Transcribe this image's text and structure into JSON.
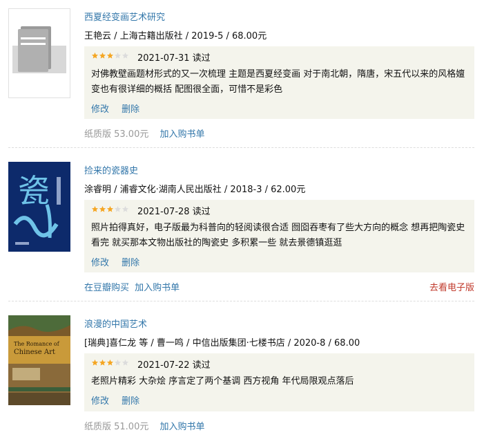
{
  "books": [
    {
      "title": "西夏经变画艺术研究",
      "pub": "王艳云 / 上海古籍出版社 / 2019-5 / 68.00元",
      "rating": 3,
      "date": "2021-07-31 读过",
      "comment": "对佛教壁画题材形式的又一次梳理 主题是西夏经变画 对于南北朝，隋唐，宋五代以来的风格嬗变也有很详细的概括 配图很全面，可惜不是彩色",
      "edit_label": "修改",
      "delete_label": "删除",
      "price_label": "纸质版 53.00元",
      "cart_label": "加入购书单",
      "cover_icon": "book-placeholder-icon"
    },
    {
      "title": "捡来的瓷器史",
      "pub": "涂睿明 / 浦睿文化·湖南人民出版社 / 2018-3 / 62.00元",
      "rating": 3,
      "date": "2021-07-28 读过",
      "comment": "照片拍得真好，电子版最为科普向的轻阅读很合适 囫囵吞枣有了些大方向的概念 想再把陶瓷史看完 就买那本文物出版社的陶瓷史 多积累一些 就去景德镇逛逛",
      "edit_label": "修改",
      "delete_label": "删除",
      "buy_label": "在豆瓣购买",
      "cart_label": "加入购书单",
      "ebook_label": "去看电子版",
      "cover_text": "瓷"
    },
    {
      "title": "浪漫的中国艺术",
      "pub": "[瑞典]喜仁龙 等 / 曹一鸣 / 中信出版集团·七楼书店 / 2020-8 / 68.00",
      "rating": 3,
      "date": "2021-07-22 读过",
      "comment": "老照片精彩 大杂烩 序言定了两个基调 西方视角 年代局限观点落后",
      "edit_label": "修改",
      "delete_label": "删除",
      "price_label": "纸质版 51.00元",
      "cart_label": "加入购书单",
      "cover_text_en": "The Romance of Chinese Art"
    }
  ],
  "colors": {
    "link": "#3377aa",
    "star_on": "#f5a623",
    "star_off": "#dcdcdc",
    "box": "#f4f4ec",
    "ebook": "#c0392b"
  }
}
